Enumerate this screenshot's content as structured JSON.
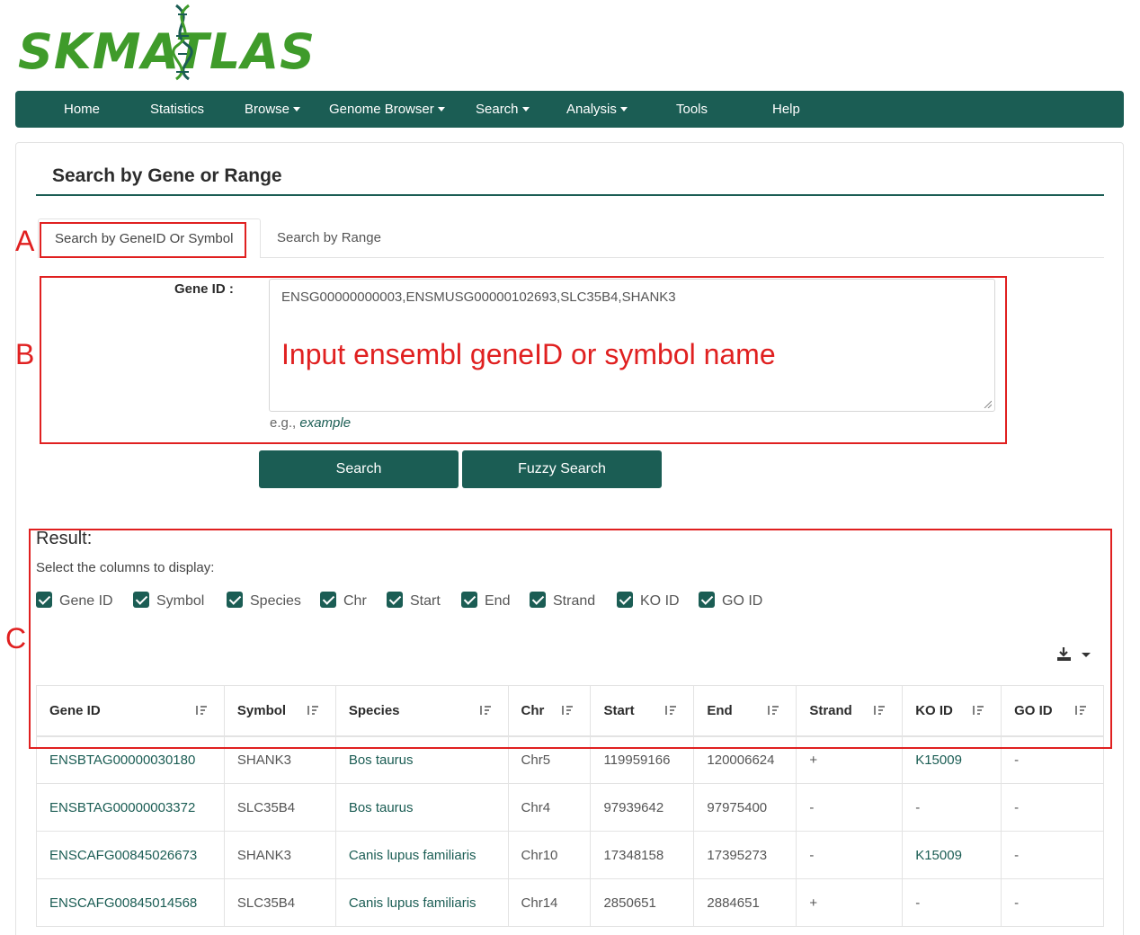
{
  "logo": {
    "text": "SKMATLAS"
  },
  "nav": {
    "items": [
      {
        "label": "Home",
        "dropdown": false
      },
      {
        "label": "Statistics",
        "dropdown": false
      },
      {
        "label": "Browse",
        "dropdown": true
      },
      {
        "label": "Genome Browser",
        "dropdown": true
      },
      {
        "label": "Search",
        "dropdown": true
      },
      {
        "label": "Analysis",
        "dropdown": true
      },
      {
        "label": "Tools",
        "dropdown": false
      },
      {
        "label": "Help",
        "dropdown": false
      }
    ]
  },
  "page": {
    "title": "Search by Gene or Range"
  },
  "tabs": [
    {
      "label": "Search by GeneID Or Symbol",
      "active": true
    },
    {
      "label": "Search by Range",
      "active": false
    }
  ],
  "form": {
    "gene_label": "Gene ID :",
    "gene_value": "ENSG00000000003,ENSMUSG00000102693,SLC35B4,SHANK3",
    "example_prefix": "e.g.,",
    "example_link": "example",
    "search_button": "Search",
    "fuzzy_button": "Fuzzy Search"
  },
  "result": {
    "title": "Result:",
    "columns_label": "Select the columns to display:",
    "column_options": [
      "Gene ID",
      "Symbol",
      "Species",
      "Chr",
      "Start",
      "End",
      "Strand",
      "KO ID",
      "GO ID"
    ],
    "headers": [
      "Gene ID",
      "Symbol",
      "Species",
      "Chr",
      "Start",
      "End",
      "Strand",
      "KO ID",
      "GO ID"
    ],
    "rows": [
      [
        "ENSBTAG00000030180",
        "SHANK3",
        "Bos taurus",
        "Chr5",
        "119959166",
        "120006624",
        "+",
        "K15009",
        "-"
      ],
      [
        "ENSBTAG00000003372",
        "SLC35B4",
        "Bos taurus",
        "Chr4",
        "97939642",
        "97975400",
        "-",
        "-",
        "-"
      ],
      [
        "ENSCAFG00845026673",
        "SHANK3",
        "Canis lupus familiaris",
        "Chr10",
        "17348158",
        "17395273",
        "-",
        "K15009",
        "-"
      ],
      [
        "ENSCAFG00845014568",
        "SLC35B4",
        "Canis lupus familiaris",
        "Chr14",
        "2850651",
        "2884651",
        "+",
        "-",
        "-"
      ]
    ]
  },
  "annotations": {
    "letters": [
      "A",
      "B",
      "C"
    ],
    "input_hint": "Input ensembl geneID or symbol name"
  },
  "colors": {
    "brand": "#1b5d54",
    "logo_green": "#3f9b2a",
    "annotation_red": "#e02020"
  }
}
